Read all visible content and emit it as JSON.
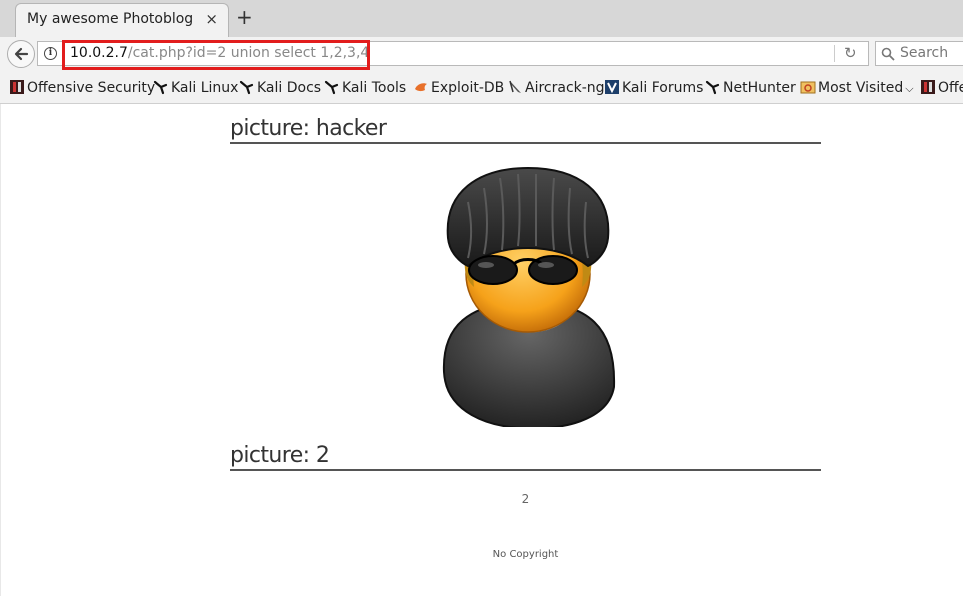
{
  "tab": {
    "title": "My awesome Photoblog",
    "close": "×",
    "new_tab": "+"
  },
  "address": {
    "host": "10.0.2.7",
    "path": "/cat.php?id=2 union select 1,2,3,4"
  },
  "search": {
    "placeholder": "Search"
  },
  "bookmarks": [
    "Offensive Security",
    "Kali Linux",
    "Kali Docs",
    "Kali Tools",
    "Exploit-DB",
    "Aircrack-ng",
    "Kali Forums",
    "NetHunter",
    "Most Visited",
    "Offe"
  ],
  "pictures": [
    {
      "heading": "picture: hacker"
    },
    {
      "heading": "picture: 2",
      "caption": "2"
    }
  ],
  "footer": "No Copyright",
  "colors": {
    "highlight": "#e21d1d"
  }
}
